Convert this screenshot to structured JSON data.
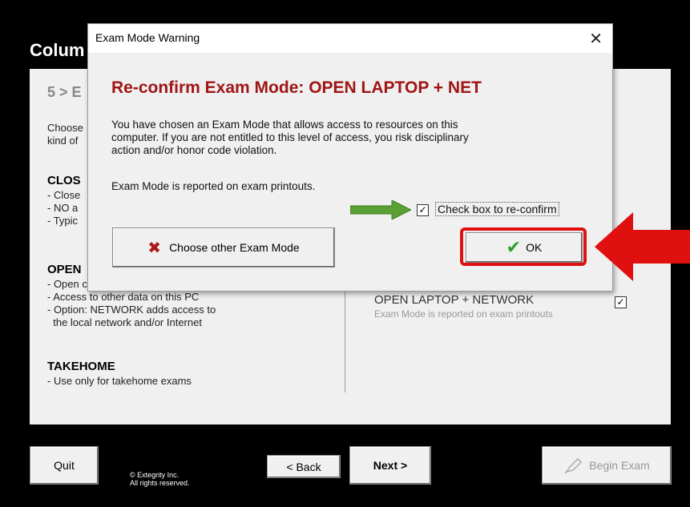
{
  "window": {
    "title": "Colum"
  },
  "panel": {
    "step_title": "5 > E",
    "choose_text_lines": [
      "Choose",
      "kind of"
    ],
    "sections": [
      {
        "heading": "CLOS",
        "lines": [
          "- Close",
          "- NO a",
          "- Typic"
        ]
      },
      {
        "heading": "OPEN",
        "lines": [
          "- Open computer exam",
          "- Access to other data on this PC",
          "- Option: NETWORK adds access to",
          "  the local network and/or Internet"
        ]
      },
      {
        "heading": "TAKEHOME",
        "lines": [
          "- Use only for takehome exams"
        ]
      }
    ],
    "option": {
      "label": "OPEN LAPTOP + NETWORK",
      "sub": "Exam Mode is reported on exam printouts",
      "checked": "✓"
    }
  },
  "bottom_bar": {
    "quit_label": "Quit",
    "copyright_line1": "© Extegrity Inc.",
    "copyright_line2": "All rights reserved.",
    "back_label": "< Back",
    "next_label": "Next >",
    "begin_label": "Begin Exam"
  },
  "dialog": {
    "title": "Exam Mode Warning",
    "close_glyph": "✕",
    "heading": "Re-confirm Exam Mode: OPEN LAPTOP + NET",
    "body_lines": [
      "You have chosen an Exam Mode that allows access to resources on this",
      "computer. If you are not entitled to this level of access, you risk disciplinary",
      "action and/or honor code violation."
    ],
    "note": "Exam Mode is reported on exam printouts.",
    "checkbox_label": "Check box to re-confirm",
    "checkbox_mark": "✓",
    "choose_other_label": "Choose other Exam Mode",
    "x_glyph": "✖",
    "ok_label": "OK",
    "ok_glyph": "✔"
  },
  "colors": {
    "heading": "#a01515",
    "highlight": "#e01010",
    "green_arrow": "#5aa033",
    "red_x": "#b01818",
    "ok_check": "#2e9e2e"
  },
  "icons": [
    "close-icon",
    "x-icon",
    "check-icon",
    "pen-icon",
    "checkbox-icon",
    "green-arrow-icon",
    "red-arrow-icon"
  ]
}
